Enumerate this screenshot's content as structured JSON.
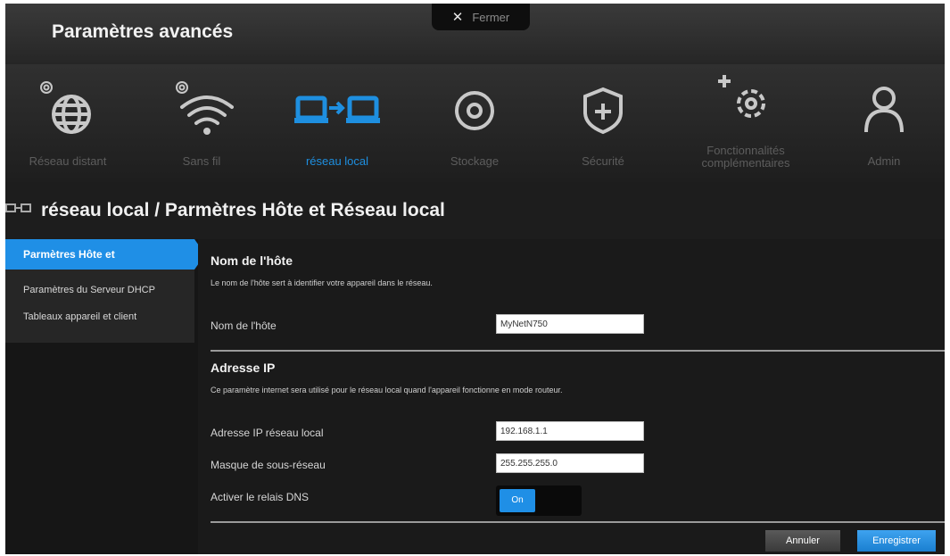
{
  "header": {
    "title": "Paramètres avancés",
    "close_label": "Fermer",
    "close_symbol": "✕"
  },
  "nav": {
    "items": [
      {
        "label": "Réseau distant",
        "icon": "globe-icon"
      },
      {
        "label": "Sans fil",
        "icon": "wifi-icon"
      },
      {
        "label": "réseau local",
        "icon": "lan-icon",
        "active": true
      },
      {
        "label": "Stockage",
        "icon": "storage-icon"
      },
      {
        "label": "Sécurité",
        "icon": "shield-icon"
      },
      {
        "label_line1": "Fonctionnalités",
        "label_line2": "complémentaires",
        "icon": "gears-icon"
      },
      {
        "label": "Admin",
        "icon": "user-icon"
      }
    ]
  },
  "page": {
    "title": "réseau local / Parmètres Hôte et Réseau local"
  },
  "sidebar": {
    "items": [
      {
        "label": "Parmètres Hôte et",
        "active": true
      },
      {
        "label": "Paramètres du Serveur DHCP"
      },
      {
        "label": "Tableaux appareil et client"
      }
    ]
  },
  "hostname_section": {
    "title": "Nom de l'hôte",
    "description": "Le nom de l'hôte sert à identifier votre appareil dans le réseau.",
    "field_label": "Nom de l'hôte",
    "field_value": "MyNetN750"
  },
  "ip_section": {
    "title": "Adresse IP",
    "description": "Ce paramètre internet sera utilisé pour le réseau local quand l'appareil fonctionne en mode routeur.",
    "ip_label": "Adresse IP réseau local",
    "ip_value": "192.168.1.1",
    "mask_label": "Masque de sous-réseau",
    "mask_value": "255.255.255.0",
    "dns_label": "Activer le relais DNS",
    "dns_toggle": "On"
  },
  "actions": {
    "cancel": "Annuler",
    "save": "Enregistrer"
  },
  "colors": {
    "accent": "#1f8fe6",
    "icon_inactive": "#c8c8c8"
  }
}
